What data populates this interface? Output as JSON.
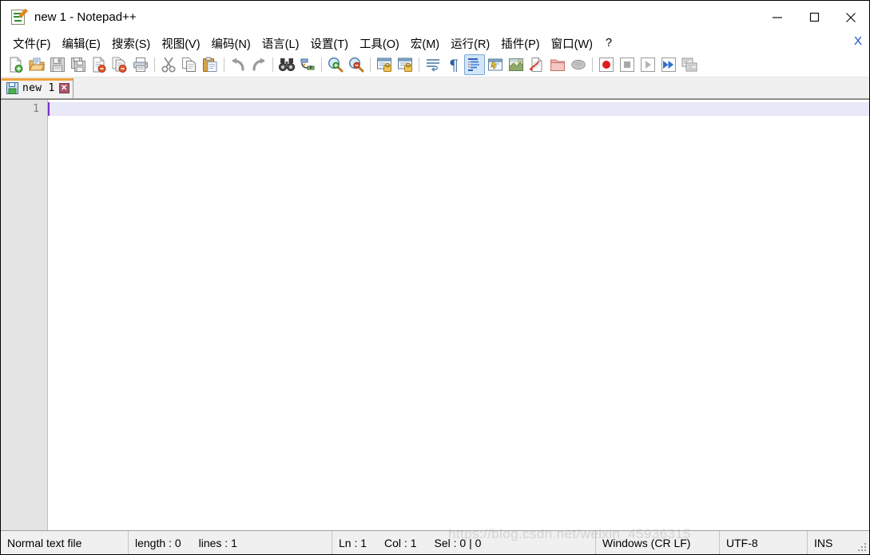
{
  "window": {
    "title": "new 1 - Notepad++",
    "icon": "notepad-plus-plus-icon",
    "controls": {
      "minimize": "—",
      "maximize": "□",
      "close": "✕"
    }
  },
  "menubar": {
    "items": [
      {
        "name": "file",
        "label": "文件(F)"
      },
      {
        "name": "edit",
        "label": "编辑(E)"
      },
      {
        "name": "search",
        "label": "搜索(S)"
      },
      {
        "name": "view",
        "label": "视图(V)"
      },
      {
        "name": "encoding",
        "label": "编码(N)"
      },
      {
        "name": "language",
        "label": "语言(L)"
      },
      {
        "name": "settings",
        "label": "设置(T)"
      },
      {
        "name": "tools",
        "label": "工具(O)"
      },
      {
        "name": "macro",
        "label": "宏(M)"
      },
      {
        "name": "run",
        "label": "运行(R)"
      },
      {
        "name": "plugins",
        "label": "插件(P)"
      },
      {
        "name": "window",
        "label": "窗口(W)"
      },
      {
        "name": "help",
        "label": "?"
      }
    ],
    "close_document": "X"
  },
  "toolbar": {
    "buttons": [
      {
        "name": "new-file-icon",
        "tooltip": "New"
      },
      {
        "name": "open-file-icon",
        "tooltip": "Open"
      },
      {
        "name": "save-icon",
        "tooltip": "Save"
      },
      {
        "name": "save-all-icon",
        "tooltip": "Save All"
      },
      {
        "name": "close-file-icon",
        "tooltip": "Close"
      },
      {
        "name": "close-all-files-icon",
        "tooltip": "Close All"
      },
      {
        "name": "print-icon",
        "tooltip": "Print"
      },
      {
        "name": "cut-icon",
        "tooltip": "Cut"
      },
      {
        "name": "copy-icon",
        "tooltip": "Copy"
      },
      {
        "name": "paste-icon",
        "tooltip": "Paste"
      },
      {
        "name": "undo-icon",
        "tooltip": "Undo"
      },
      {
        "name": "redo-icon",
        "tooltip": "Redo"
      },
      {
        "name": "find-icon",
        "tooltip": "Find"
      },
      {
        "name": "replace-icon",
        "tooltip": "Replace"
      },
      {
        "name": "zoom-in-icon",
        "tooltip": "Zoom In"
      },
      {
        "name": "zoom-out-icon",
        "tooltip": "Zoom Out"
      },
      {
        "name": "sync-vertical-scroll-icon",
        "tooltip": "Synchronize Vertical Scrolling"
      },
      {
        "name": "sync-horizontal-scroll-icon",
        "tooltip": "Synchronize Horizontal Scrolling"
      },
      {
        "name": "word-wrap-icon",
        "tooltip": "Word wrap"
      },
      {
        "name": "show-all-characters-icon",
        "tooltip": "Show All Characters"
      },
      {
        "name": "indent-guide-icon",
        "tooltip": "Show Indent Guide",
        "active": true
      },
      {
        "name": "ui-settings-icon",
        "tooltip": "User Defined Language"
      },
      {
        "name": "document-map-icon",
        "tooltip": "Document Map"
      },
      {
        "name": "function-list-icon",
        "tooltip": "Function List"
      },
      {
        "name": "folder-as-workspace-icon",
        "tooltip": "Folder as Workspace"
      },
      {
        "name": "monitoring-icon",
        "tooltip": "Monitoring"
      },
      {
        "name": "record-macro-icon",
        "tooltip": "Start Recording"
      },
      {
        "name": "stop-macro-icon",
        "tooltip": "Stop Recording"
      },
      {
        "name": "play-macro-icon",
        "tooltip": "Playback"
      },
      {
        "name": "fast-playback-icon",
        "tooltip": "Run a Macro Multiple Times"
      },
      {
        "name": "run-macro-dialog-icon",
        "tooltip": "Run"
      }
    ]
  },
  "tabs": [
    {
      "name": "tab-new-1",
      "label": "new 1",
      "active": true,
      "icon": "save-floppy-icon",
      "close": "✕"
    }
  ],
  "editor": {
    "line_numbers": [
      "1"
    ],
    "content": "",
    "caret_line": 1
  },
  "statusbar": {
    "file_type": "Normal text file",
    "length_label": "length : 0",
    "lines_label": "lines : 1",
    "ln": "Ln : 1",
    "col": "Col : 1",
    "sel": "Sel : 0 | 0",
    "eol": "Windows (CR LF)",
    "encoding": "UTF-8",
    "insert_mode": "INS"
  },
  "watermark": {
    "text": "https://blog.csdn.net/weixin_45936315"
  },
  "colors": {
    "tab_accent": "#f0a23c",
    "gutter_bg": "#e4e4e4",
    "current_line": "#e8e8f8",
    "caret": "#7a2fd0",
    "statusbar_bg": "#f0f0f0",
    "active_tool_bg": "#d3e5f8"
  }
}
